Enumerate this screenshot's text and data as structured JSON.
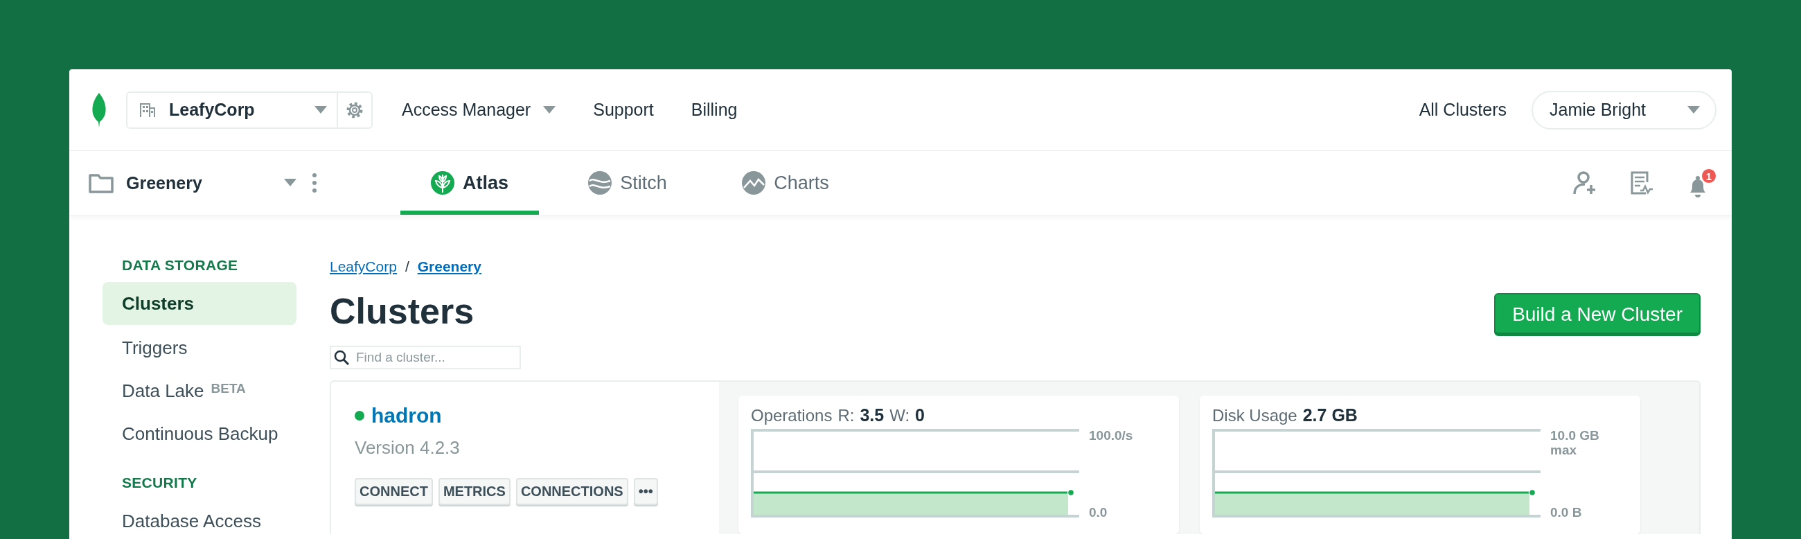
{
  "org_selector": {
    "name": "LeafyCorp"
  },
  "top_nav": [
    {
      "label": "Access Manager",
      "has_menu": true
    },
    {
      "label": "Support",
      "has_menu": false
    },
    {
      "label": "Billing",
      "has_menu": false
    }
  ],
  "all_clusters_link": "All Clusters",
  "user_menu": {
    "name": "Jamie Bright"
  },
  "project": {
    "name": "Greenery"
  },
  "product_tabs": [
    {
      "kind": "atlas",
      "label": "Atlas",
      "selected": true
    },
    {
      "kind": "stitch",
      "label": "Stitch",
      "selected": false
    },
    {
      "kind": "charts",
      "label": "Charts",
      "selected": false
    }
  ],
  "notifications": {
    "count": "1"
  },
  "sidebar": {
    "sections": [
      {
        "title": "DATA STORAGE",
        "items": [
          {
            "label": "Clusters",
            "selected": true
          },
          {
            "label": "Triggers",
            "selected": false
          },
          {
            "label": "Data Lake",
            "badge": "BETA",
            "selected": false
          },
          {
            "label": "Continuous Backup",
            "selected": false
          }
        ]
      },
      {
        "title": "SECURITY",
        "items": [
          {
            "label": "Database Access",
            "selected": false
          }
        ]
      }
    ]
  },
  "breadcrumb": {
    "separator": "/",
    "items": [
      {
        "label": "LeafyCorp",
        "current": false
      },
      {
        "label": "Greenery",
        "current": true
      }
    ]
  },
  "page_title": "Clusters",
  "primary_button": "Build a New Cluster",
  "search": {
    "placeholder": "Find a cluster..."
  },
  "cluster": {
    "name": "hadron",
    "color": "#13aa52",
    "version": "Version 4.2.3",
    "actions": [
      "CONNECT",
      "METRICS",
      "CONNECTIONS",
      "•••"
    ]
  },
  "metrics": [
    {
      "kind": "operations",
      "title": "Operations",
      "reads_label": "R:",
      "reads": "3.5",
      "writes_label": "W:",
      "writes": "0",
      "axis_max": "100.0/s",
      "axis_min": "0.0"
    },
    {
      "kind": "disk",
      "title": "Disk Usage",
      "value": "2.7 GB",
      "axis_max": "10.0 GB",
      "axis_max_note": "max",
      "axis_min": "0.0 B"
    }
  ]
}
